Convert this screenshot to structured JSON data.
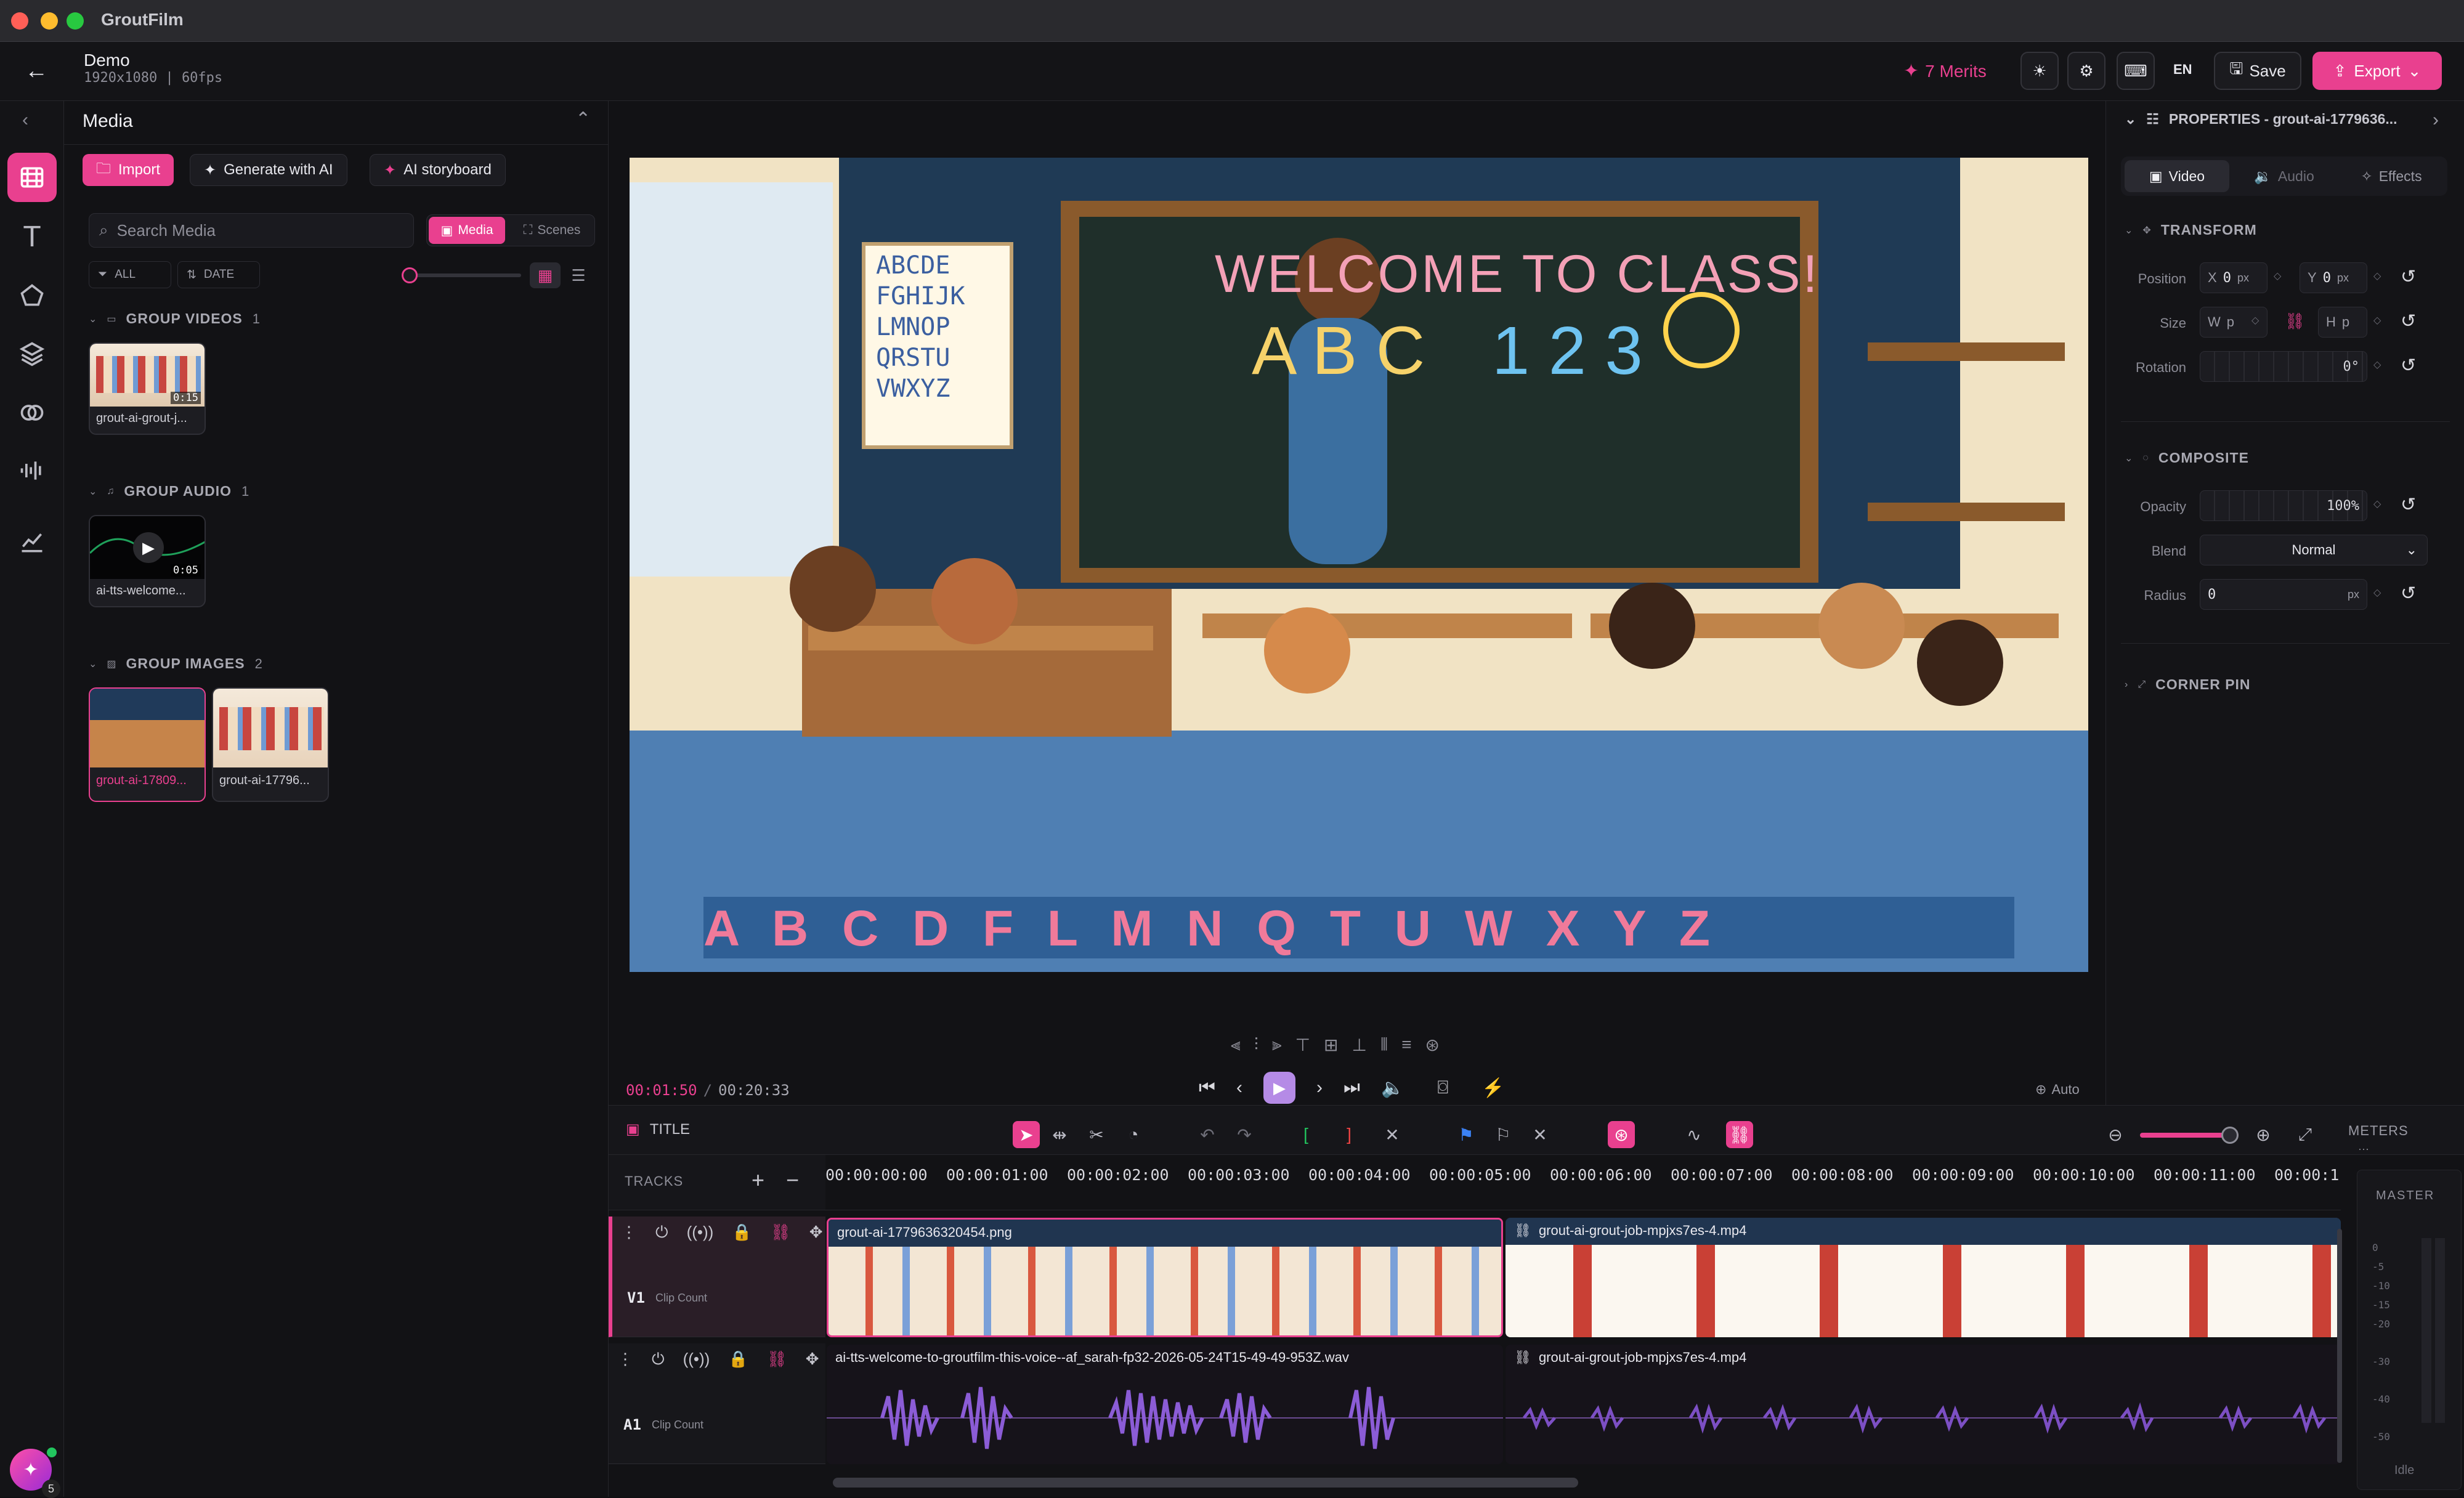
{
  "app": {
    "title": "GroutFilm"
  },
  "project": {
    "name": "Demo",
    "meta": "1920x1080 | 60fps"
  },
  "header": {
    "merits": "7 Merits",
    "lang": "EN",
    "save": "Save",
    "export": "Export"
  },
  "media": {
    "title": "Media",
    "import": "Import",
    "generate": "Generate with AI",
    "storyboard": "AI storyboard",
    "search_placeholder": "Search Media",
    "tab_media": "Media",
    "tab_scenes": "Scenes",
    "filter_all": "ALL",
    "filter_date": "DATE",
    "groups": [
      {
        "label": "GROUP VIDEOS",
        "count": "1",
        "items": [
          {
            "name": "grout-ai-grout-j...",
            "duration": "0:15"
          }
        ]
      },
      {
        "label": "GROUP AUDIO",
        "count": "1",
        "items": [
          {
            "name": "ai-tts-welcome...",
            "duration": "0:05"
          }
        ]
      },
      {
        "label": "GROUP IMAGES",
        "count": "2",
        "items": [
          {
            "name": "grout-ai-17809..."
          },
          {
            "name": "grout-ai-17796..."
          }
        ]
      }
    ]
  },
  "playback": {
    "current": "00:01:50",
    "separator": "/",
    "total": "00:20:33",
    "zoom": "Auto"
  },
  "properties": {
    "title": "PROPERTIES - grout-ai-1779636...",
    "tabs": [
      "Video",
      "Audio",
      "Effects"
    ],
    "transform": {
      "label": "TRANSFORM",
      "position": "Position",
      "x_label": "X",
      "x_val": "0",
      "y_label": "Y",
      "y_val": "0",
      "unit": "px",
      "size": "Size",
      "w_label": "W",
      "w_val": "p",
      "h_label": "H",
      "h_val": "p",
      "rotation": "Rotation",
      "rotation_val": "0°"
    },
    "composite": {
      "label": "COMPOSITE",
      "opacity": "Opacity",
      "opacity_val": "100%",
      "blend": "Blend",
      "blend_val": "Normal",
      "radius": "Radius",
      "radius_val": "0",
      "radius_unit": "px"
    },
    "corner_pin": "CORNER PIN"
  },
  "timeline": {
    "title": "TITLE",
    "tracks_label": "TRACKS",
    "meters_label": "METERS",
    "master": "MASTER",
    "idle": "Idle",
    "meter_scale": [
      "0",
      "-5",
      "-10",
      "-15",
      "-20",
      "-30",
      "-40",
      "-50"
    ],
    "ruler": [
      "00:00:00:00",
      "00:00:01:00",
      "00:00:02:00",
      "00:00:03:00",
      "00:00:04:00",
      "00:00:05:00",
      "00:00:06:00",
      "00:00:07:00",
      "00:00:08:00",
      "00:00:09:00",
      "00:00:10:00",
      "00:00:11:00",
      "00:00:1"
    ],
    "tracks": [
      {
        "id": "V1",
        "sub": "Clip Count",
        "clips": [
          "grout-ai-1779636320454.png",
          "grout-ai-grout-job-mpjxs7es-4.mp4"
        ]
      },
      {
        "id": "A1",
        "sub": "Clip Count",
        "clips": [
          "ai-tts-welcome-to-groutfilm-this-voice--af_sarah-fp32-2026-05-24T15-49-49-953Z.wav",
          "grout-ai-grout-job-mpjxs7es-4.mp4"
        ]
      }
    ]
  },
  "preview": {
    "board_text": "WELCOME TO CLASS!",
    "abc": "A B C",
    "num": "1 2 3",
    "poster": [
      "ABCDE",
      "FGHIJK",
      "LMNOP",
      "QRSTU",
      "VWXYZ"
    ],
    "rug": "A B C D F L M N Q T U W X Y Z"
  },
  "avatar_badge": "5",
  "colors": {
    "accent": "#e9408f",
    "bg": "#121215",
    "panel": "#141417"
  }
}
